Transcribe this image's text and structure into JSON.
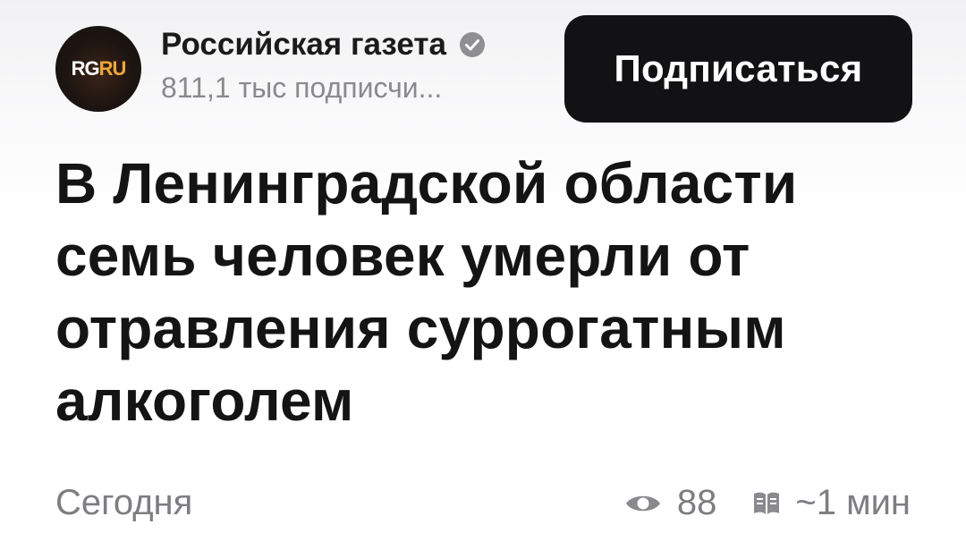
{
  "channel": {
    "logo_left": "RG",
    "logo_right": "RU",
    "name": "Российская газета",
    "subscribers": "811,1 тыс подписчи..."
  },
  "subscribe_button": {
    "label": "Подписаться"
  },
  "article": {
    "headline": "В Ленинградской области семь человек умерли от отравления суррогатным алкоголем"
  },
  "meta": {
    "date": "Сегодня",
    "views": "88",
    "read_time": "~1 мин"
  },
  "icons": {
    "verified": "verified-check-icon",
    "views": "eye-icon",
    "read_time": "book-icon"
  },
  "colors": {
    "button_bg": "#121214",
    "button_text": "#ffffff",
    "logo_accent": "#f0a63a",
    "muted_text": "#7d7d82",
    "headline": "#141414"
  }
}
